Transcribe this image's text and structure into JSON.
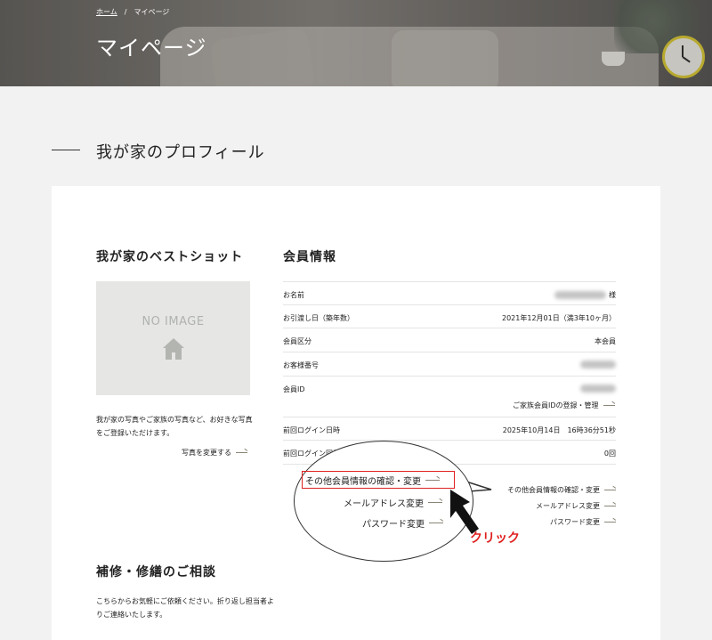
{
  "breadcrumb": {
    "home": "ホーム",
    "separator": "/",
    "current": "マイページ"
  },
  "hero": {
    "title": "マイページ"
  },
  "section": {
    "title": "我が家のプロフィール"
  },
  "photo": {
    "heading": "我が家のベストショット",
    "placeholder": "NO IMAGE",
    "description": "我が家の写真やご家族の写真など、お好きな写真をご登録いただけます。",
    "change_link": "写真を変更する"
  },
  "member": {
    "heading": "会員情報",
    "rows": [
      {
        "label": "お名前",
        "value": "",
        "suffix": "様"
      },
      {
        "label": "お引渡し日（築年数）",
        "value": "2021年12月01日（満3年10ヶ月）"
      },
      {
        "label": "会員区分",
        "value": "本会員"
      },
      {
        "label": "お客様番号",
        "value": ""
      },
      {
        "label": "会員ID",
        "value": ""
      },
      {
        "label": "前回ログイン日時",
        "value": "2025年10月14日　16時36分51秒"
      },
      {
        "label": "前回ログイン回数",
        "value": "0回"
      }
    ],
    "family_link": "ご家族会員IDの登録・管理",
    "links": [
      "その他会員情報の確認・変更",
      "メールアドレス変更",
      "パスワード変更"
    ]
  },
  "callout": {
    "items": [
      "その他会員情報の確認・変更",
      "メールアドレス変更",
      "パスワード変更"
    ],
    "click_label": "クリック",
    "highlight_color": "#e02020"
  },
  "repair": {
    "heading": "補修・修繕のご相談",
    "description": "こちらからお気軽にご依頼ください。折り返し担当者よりご連絡いたします。"
  }
}
